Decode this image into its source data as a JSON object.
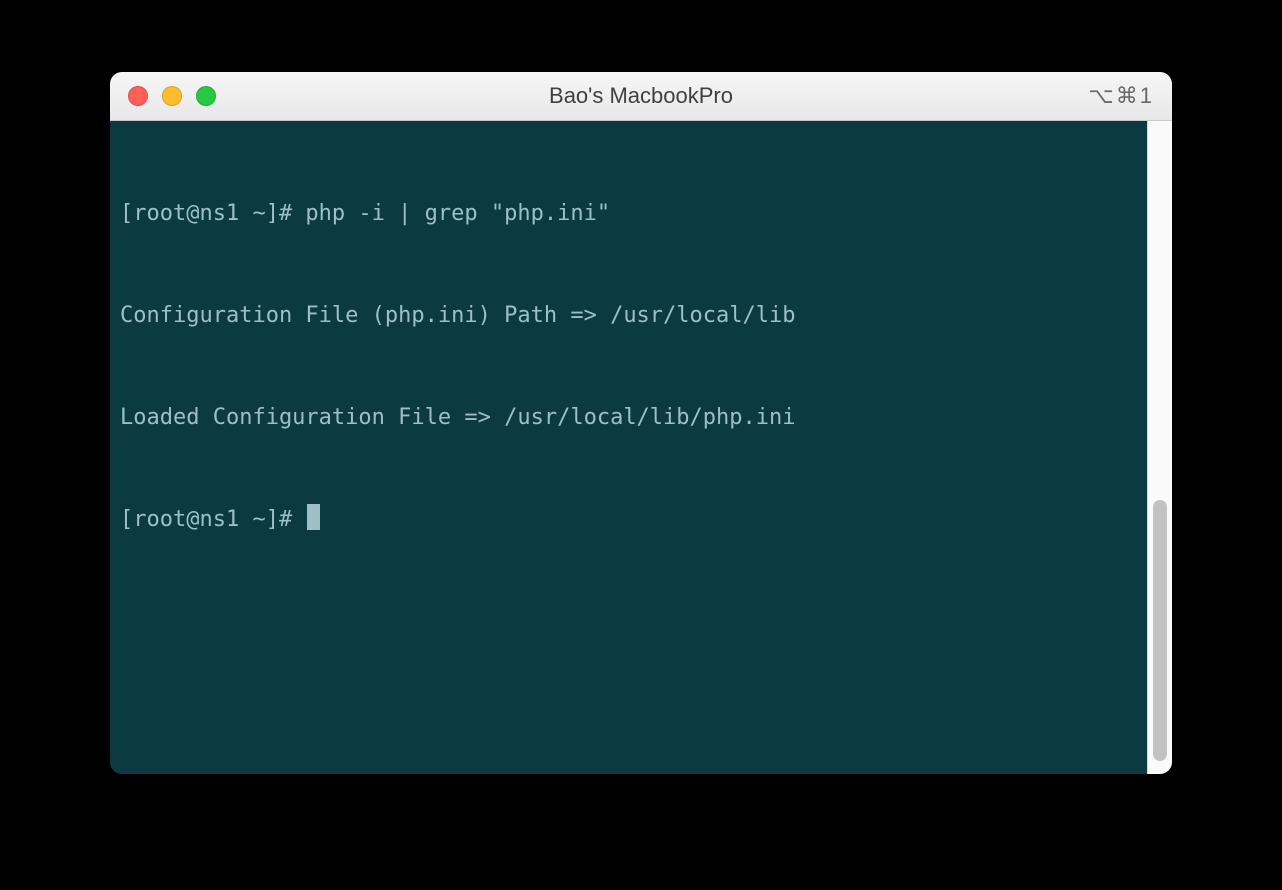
{
  "window": {
    "title": "Bao's MacbookPro",
    "tab_hint": "⌥⌘1"
  },
  "traffic_lights": {
    "close": "#ff5f57",
    "minimize": "#febc2e",
    "zoom": "#28c840"
  },
  "terminal": {
    "prompt": "[root@ns1 ~]# ",
    "lines": [
      "[root@ns1 ~]# php -i | grep \"php.ini\"",
      "Configuration File (php.ini) Path => /usr/local/lib",
      "Loaded Configuration File => /usr/local/lib/php.ini"
    ],
    "cursor_prompt": "[root@ns1 ~]# "
  },
  "scrollbar": {
    "thumb_top_pct": 58,
    "thumb_height_pct": 40
  },
  "colors": {
    "terminal_bg": "#0b3a43",
    "terminal_fg": "#9dbfc5",
    "titlebar_text": "#404040"
  }
}
